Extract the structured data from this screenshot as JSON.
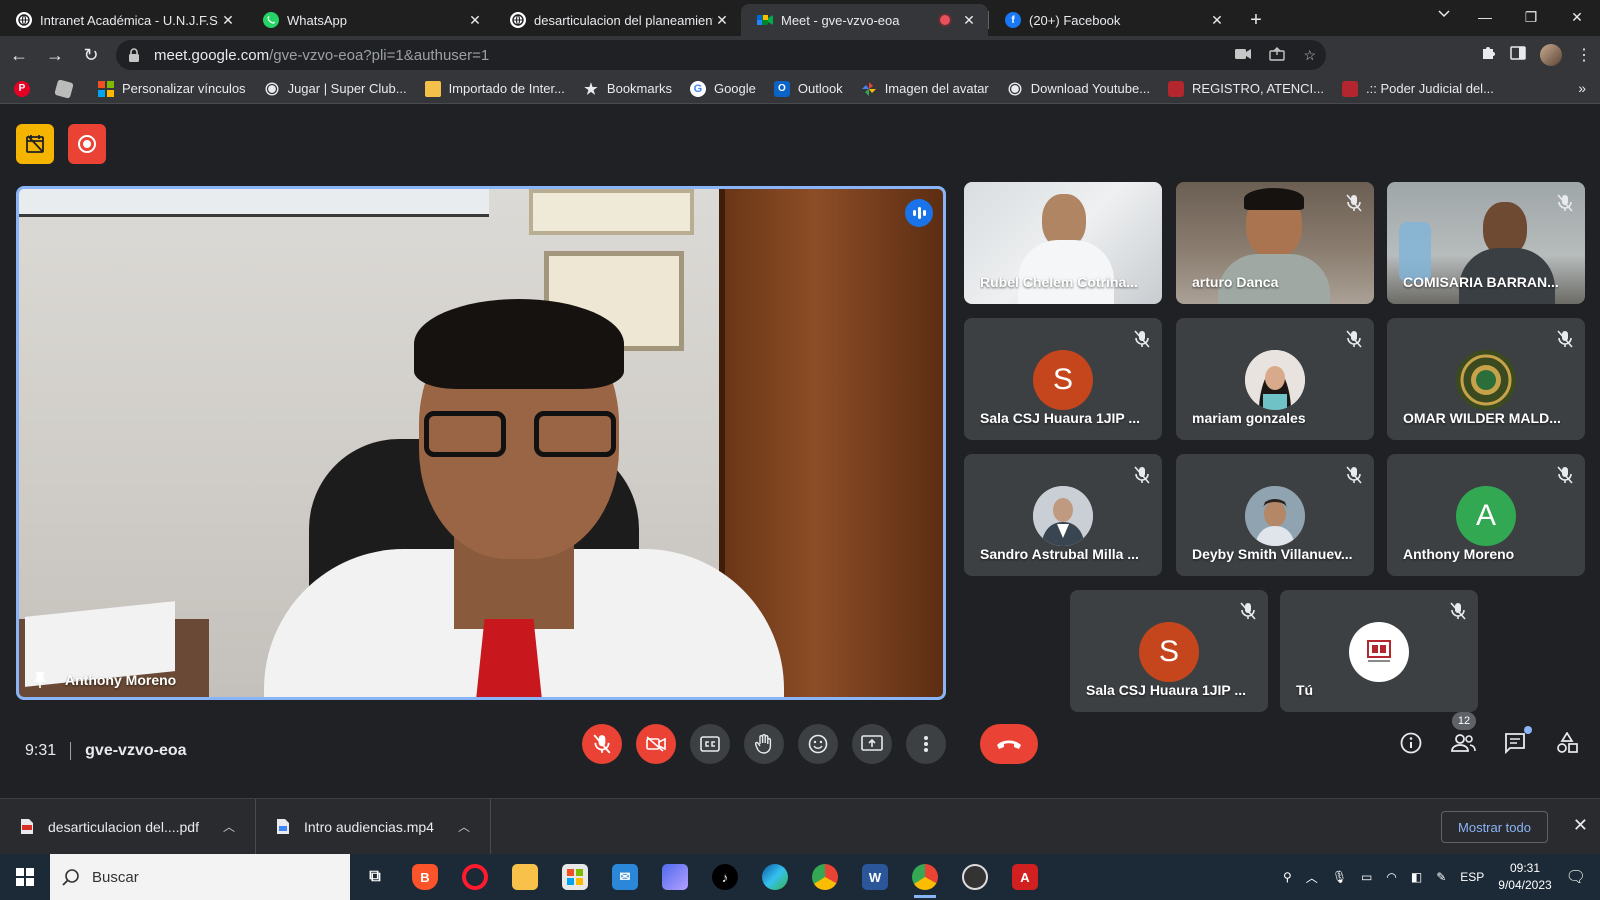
{
  "browser": {
    "tabs": [
      {
        "title": "Intranet Académica - U.N.J.F.S.C.",
        "icon": "globe-icon",
        "active": false
      },
      {
        "title": "WhatsApp",
        "icon": "whatsapp-icon",
        "active": false
      },
      {
        "title": "desarticulacion del planeamiento",
        "icon": "globe-icon",
        "active": false
      },
      {
        "title": "Meet - gve-vzvo-eoa",
        "icon": "meet-icon",
        "active": true,
        "recording": true
      },
      {
        "title": "(20+) Facebook",
        "icon": "facebook-icon",
        "active": false
      }
    ],
    "url_host": "meet.google.com",
    "url_path": "/gve-vzvo-eoa?pli=1&authuser=1",
    "bookmarks": [
      {
        "label": "Personalizar vínculos",
        "icon": "apps-grid-icon"
      },
      {
        "label": "Jugar | Super Club...",
        "icon": "globe-icon"
      },
      {
        "label": "Importado de Inter...",
        "icon": "folder-icon"
      },
      {
        "label": "Bookmarks",
        "icon": "star-icon"
      },
      {
        "label": "Google",
        "icon": "google-icon"
      },
      {
        "label": "Outlook",
        "icon": "outlook-icon"
      },
      {
        "label": "Imagen del avatar",
        "icon": "pinwheel-icon"
      },
      {
        "label": "Download Youtube...",
        "icon": "globe-icon"
      },
      {
        "label": "REGISTRO, ATENCI...",
        "icon": "registry-icon"
      },
      {
        "label": ".:: Poder Judicial del...",
        "icon": "registry-icon"
      }
    ]
  },
  "meet": {
    "main_speaker": "Anthony Moreno",
    "time": "9:31",
    "meeting_code": "gve-vzvo-eoa",
    "participant_count": "12",
    "tiles": [
      {
        "name": "Rubel Chelem Cotrina...",
        "type": "video",
        "muted": false
      },
      {
        "name": "arturo Danca",
        "type": "video",
        "muted": true
      },
      {
        "name": "COMISARIA BARRAN...",
        "type": "video",
        "muted": true
      },
      {
        "name": "Sala CSJ Huaura 1JIP ...",
        "type": "letter",
        "letter": "S",
        "color": "#c5461c",
        "muted": true
      },
      {
        "name": "mariam gonzales",
        "type": "photo",
        "color": "#e9e1dc",
        "muted": true
      },
      {
        "name": "OMAR WILDER MALD...",
        "type": "photo",
        "color": "#3b4a1f",
        "muted": true
      },
      {
        "name": "Sandro Astrubal Milla ...",
        "type": "photo",
        "color": "#a9b2bb",
        "muted": true
      },
      {
        "name": "Deyby Smith Villanuev...",
        "type": "photo",
        "color": "#8a7a66",
        "muted": true
      },
      {
        "name": "Anthony Moreno",
        "type": "letter",
        "letter": "A",
        "color": "#33a852",
        "muted": true
      },
      {
        "name": "Sala CSJ Huaura 1JIP ...",
        "type": "letter",
        "letter": "S",
        "color": "#c5461c",
        "muted": true
      },
      {
        "name": "Tú",
        "type": "photo",
        "color": "#ffffff",
        "muted": true
      }
    ]
  },
  "downloads": {
    "items": [
      {
        "name": "desarticulacion del....pdf",
        "icon": "pdf-icon"
      },
      {
        "name": "Intro audiencias.mp4",
        "icon": "file-icon"
      }
    ],
    "show_all": "Mostrar todo"
  },
  "taskbar": {
    "search_placeholder": "Buscar",
    "lang": "ESP",
    "time": "09:31",
    "date": "9/04/2023"
  },
  "colors": {
    "meet_bg": "#202124",
    "accent_blue": "#8ab4f8",
    "danger_red": "#ea4335"
  }
}
